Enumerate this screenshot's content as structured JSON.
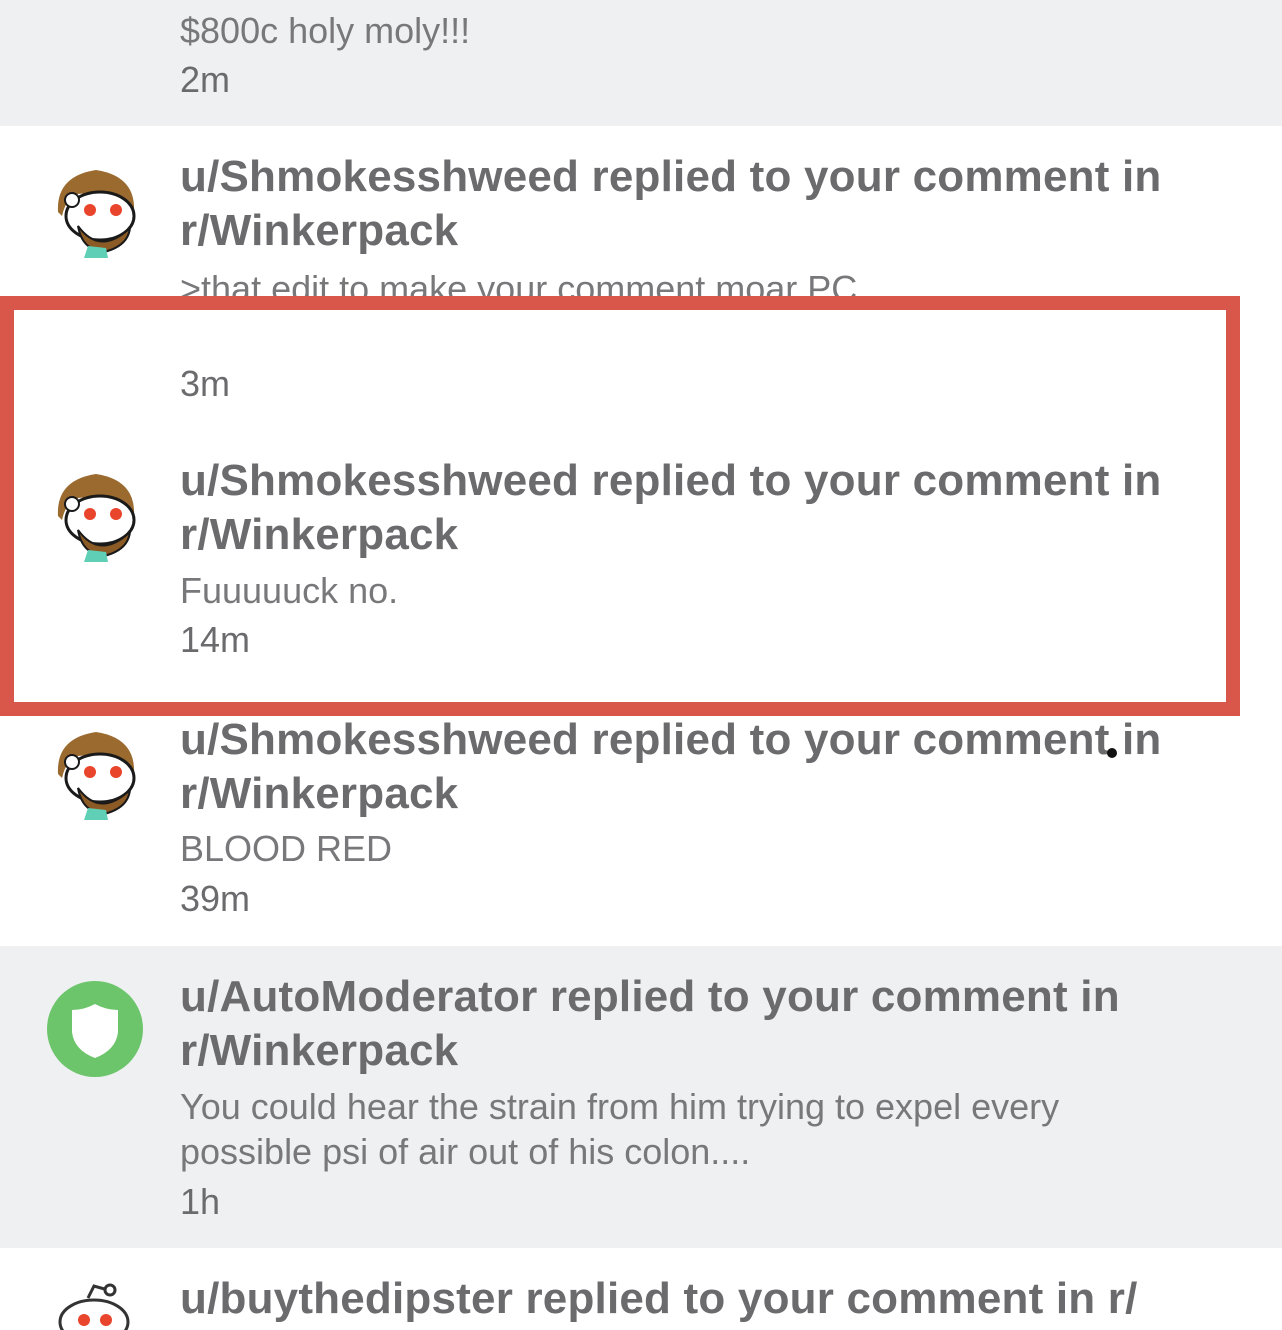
{
  "notifications": [
    {
      "body": "$800c holy moly!!!",
      "time": "2m"
    },
    {
      "title_line1": "u/Shmokesshweed replied to your comment in",
      "title_line2": "r/Winkerpack",
      "body": ">that edit to make your comment moar PC",
      "time": "3m",
      "avatar": "snoo-bearded-avatar"
    },
    {
      "title_line1": "u/Shmokesshweed replied to your comment in",
      "title_line2": "r/Winkerpack",
      "body": "Fuuuuuck no.",
      "time": "14m",
      "avatar": "snoo-bearded-avatar"
    },
    {
      "title_line1": "u/Shmokesshweed replied to your comment in",
      "title_line2": "r/Winkerpack",
      "body": "BLOOD RED",
      "time": "39m",
      "avatar": "snoo-bearded-avatar"
    },
    {
      "title_line1": "u/AutoModerator replied to your comment in",
      "title_line2": "r/Winkerpack",
      "body_line1": "You could hear the strain from him trying to expel every",
      "body_line2": "possible psi of air out of his colon....",
      "time": "1h",
      "avatar": "automoderator-shield-avatar"
    },
    {
      "title_line1": "u/buythedipster replied to your comment in r/",
      "avatar": "snoo-default-avatar"
    }
  ],
  "colors": {
    "highlight": "#d9574a",
    "unread_bg": "#eff0f2",
    "read_bg": "#ffffff",
    "mod_green": "#6cc56b"
  }
}
